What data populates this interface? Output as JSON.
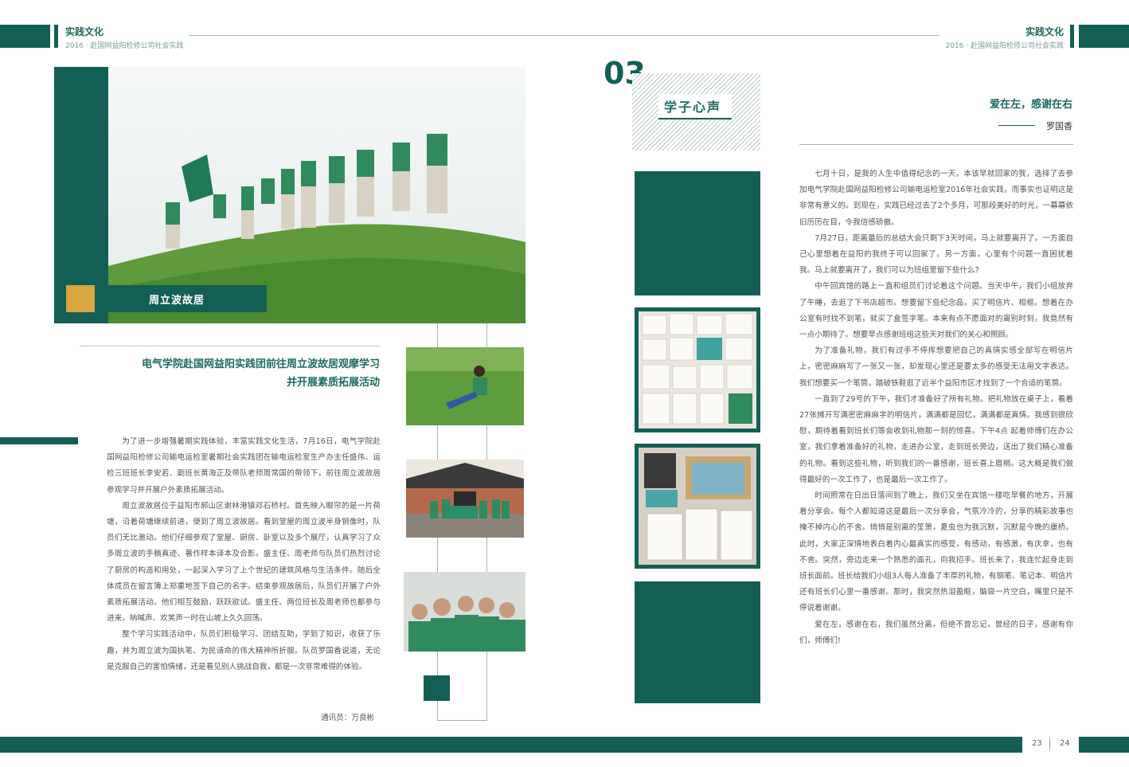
{
  "header": {
    "left_title": "实践文化",
    "left_sub": "2016 · 赴国网益阳检修公司社会实践",
    "right_title": "实践文化",
    "right_sub": "2016 · 赴国网益阳检修公司社会实践"
  },
  "left_page": {
    "photo_caption": "周立波故居",
    "article_title_line1": "电气学院赴国网益阳实践团前往周立波故居观摩学习",
    "article_title_line2": "并开展素质拓展活动",
    "paragraphs": [
      "为了进一步增强暑期实践体验，丰富实践文化生活，7月16日，电气学院赴国网益阳检修公司输电运检室暑期社会实践团在输电运检室生产办主任盛伟、运检三班班长李安若、副班长黄海正及带队老师周常国的带领下，前往周立波故居参观学习并开展户外素质拓展活动。",
      "周立波故居位于益阳市郝山区谢林港镇邓石桥村。首先映入眼帘的是一片荷塘，沿着荷塘继续前进，便到了周立波故居。看到堂屋的周立波半身铜像时，队员们无比激动。他们仔细参观了堂屋、厨房、卧室以及多个展厅，认真学习了众多周立波的手稿真迹、著作样本译本及合影。盛主任、周老师与队员们热烈讨论了厨房的构造和用处，一起深入学习了上个世纪的建筑风格与生活条件。随后全体成员在留言簿上郑重地签下自己的名字。结束参观故居后，队员们开展了户外素质拓展活动。他们相互鼓励，跃跃欲试。盛主任、两位班长及周老师也都参与进来，呐喊声、欢笑声一时在山坡上久久回荡。",
      "整个学习实践活动中，队员们积极学习、团结互助，学到了知识，收获了乐趣，并为周立波为国执笔、为民请命的伟大精神所折服。队员罗国香说道，无论是克服自己的害怕情绪，还是看见别人挑战自我，都是一次非常难得的体验。"
    ],
    "author": "通讯员：万良彬"
  },
  "right_page": {
    "section_number": "03",
    "section_title": "学子心声",
    "essay_title": "爱在左，感谢在右",
    "essay_author": "罗国香",
    "paragraphs": [
      "七月十日，是我的人生中值得纪念的一天。本该早就回家的我，选择了去参加电气学院赴国网益阳检修公司输电运检室2016年社会实践，而事实也证明这是非常有意义的。到现在，实践已经过去了2个多月，可那段美好的时光，一幕幕依旧历历在目，令我倍感骄傲。",
      "7月27日，距离最后的总结大会只剩下3天时间，马上就要离开了。一方面自己心里想着在益阳的我终于可以回家了。另一方面，心里有个问题一直困扰着我。马上就要离开了，我们可以为班组里留下些什么?",
      "中午回宾馆的路上一直和组员们讨论着这个问题。当天中午，我们小组放弃了午睡，去逛了下书店超市。想要留下些纪念品，买了明信片、相框。想着在办公室有时找不到笔，就买了盒签字笔。本来有点不愿面对的离别时刻，我竟然有一点小期待了。想要早点感谢班组这些天对我们的关心和照顾。",
      "为了准备礼物，我们有过手不停挥想要把自己的真情实感全部写在明信片上，密密麻麻写了一张又一张，却发现心里还是要太多的感受无法用文字表达。我们想要买一个笔筒，踏破铁鞋逛了近半个益阳市区才找到了一个合适的笔筒。",
      "一直到了29号的下午，我们才准备好了所有礼物。把礼物放在桌子上，看着27张摊开写满密密麻麻字的明信片，满满都是回忆，满满都是真情。我感到很欣慰，期待着看到班长们等会收到礼物那一刻的惊喜。下午4点 起着师傅们在办公室，我们拿着准备好的礼物，走进办公室，走到班长旁边，送出了我们精心准备的礼物。看到这些礼物，听到我们的一番感谢，班长喜上眉梢。这大概是我们做得最好的一次工作了，也是最后一次工作了。",
      "时间照常在日出日落间到了晚上，我们又坐在宾馆一楼吃早餐的地方，开展着分享会。每个人都知道这是最后一次分享会，气氛冷冷的，分享的精彩故事也掩不掉内心的不舍。悄悄是别离的笙箫，夏虫也为我沉默，沉默是今晚的康桥。此时，大家正深情地表白着内心最真实的感受，有感动，有感激，有庆幸，也有不舍。突然，旁边走来一个熟悉的面孔，向我招手。班长来了，我连忙起身走到班长面前。班长给我们小组3人每人准备了丰厚的礼物，有钢笔、笔记本、明信片还有班长们心里一番感谢。那时，我突然热泪盈眶，脑袋一片空白，嘴里只是不停说着谢谢。",
      "爱在左，感谢在右，我们虽然分离，但绝不曾忘记，曾经的日子，感谢有你们，师傅们!"
    ]
  },
  "footer": {
    "page_left": "23",
    "page_right": "24"
  },
  "colors": {
    "brand_green": "#145f55",
    "gold": "#d9a640",
    "line": "#9bbab4"
  }
}
